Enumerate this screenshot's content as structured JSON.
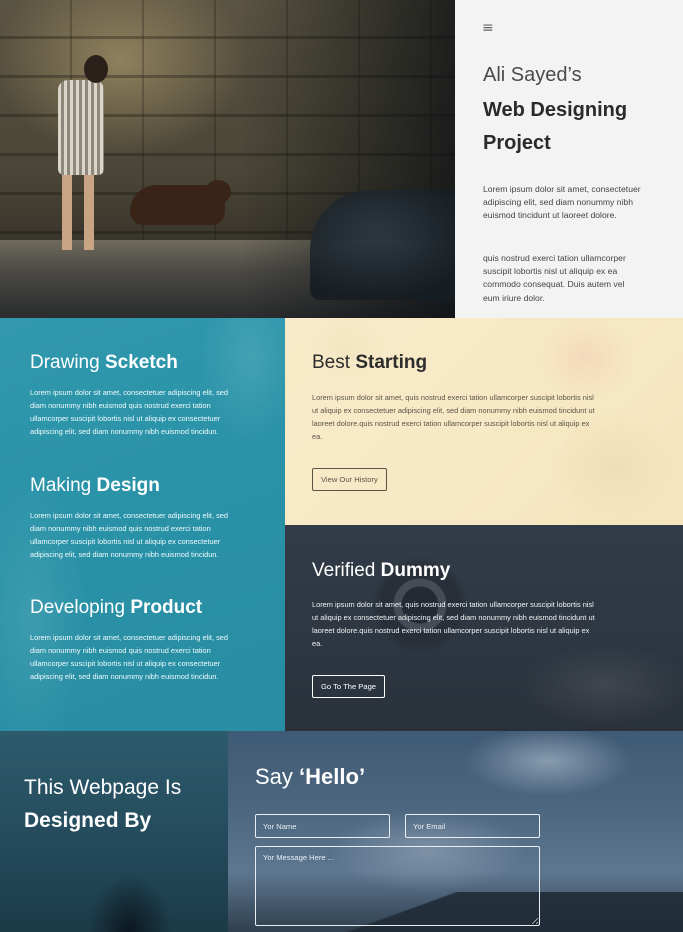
{
  "hero": {
    "menu_icon": "hamburger-icon",
    "author": "Ali Sayed’s",
    "project_title": "Web Designing Project",
    "paragraph_1": "Lorem ipsum dolor sit amet, consectetuer adipiscing elit, sed diam nonummy nibh euismod tincidunt ut laoreet dolore.",
    "paragraph_2": "quis nostrud exerci tation ullamcorper suscipit lobortis nisl ut aliquip ex ea commodo consequat. Duis autem vel eum iriure dolor."
  },
  "features": [
    {
      "title_light": "Drawing",
      "title_bold": "Scketch",
      "text": "Lorem ipsum dolor sit amet, consectetuer adipiscing elit, sed diam nonummy nibh euismod quis nostrud exerci tation ullamcorper suscipit lobortis nisl ut aliquip ex consectetuer adipiscing elit, sed diam nonummy nibh euismod tincidun."
    },
    {
      "title_light": "Making",
      "title_bold": "Design",
      "text": "Lorem ipsum dolor sit amet, consectetuer adipiscing elit, sed diam nonummy nibh euismod quis nostrud exerci tation ullamcorper suscipit lobortis nisl ut aliquip ex consectetuer adipiscing elit, sed diam nonummy nibh euismod tincidun."
    },
    {
      "title_light": "Developing",
      "title_bold": "Product",
      "text": "Lorem ipsum dolor sit amet, consectetuer adipiscing elit, sed diam nonummy nibh euismod quis nostrud exerci tation ullamcorper suscipit lobortis nisl ut aliquip ex consectetuer adipiscing elit, sed diam nonummy nibh euismod tincidun."
    }
  ],
  "best_starting": {
    "title_light": "Best",
    "title_bold": "Starting",
    "text": "Lorem ipsum dolor sit amet, quis nostrud exerci tation ullamcorper suscipit lobortis nisl ut aliquip ex consectetuer adipiscing elit, sed diam nonummy nibh euismod tincidunt ut laoreet dolore.quis nostrud exerci tation ullamcorper suscipit lobortis nisl ut aliquip ex ea.",
    "button_label": "View Our History"
  },
  "verified_dummy": {
    "title_light": "Verified",
    "title_bold": "Dummy",
    "text": "Lorem ipsum dolor sit amet, quis nostrud exerci tation ullamcorper suscipit lobortis nisl ut aliquip ex consectetuer adipiscing elit, sed diam nonummy nibh euismod tincidunt ut laoreet dolore.quis nostrud exerci tation ullamcorper suscipit lobortis nisl ut aliquip ex ea.",
    "button_label": "Go To The Page"
  },
  "designed_by": {
    "line_1": "This Webpage Is",
    "line_2": "Designed By"
  },
  "contact": {
    "title_light": "Say",
    "title_bold": "‘Hello’",
    "name_placeholder": "Yor Name",
    "email_placeholder": "Yor Email",
    "message_placeholder": "Yor Message Here ..."
  },
  "colors": {
    "hero_panel_bg": "#f3f3f3",
    "teal": "#2f93a8",
    "cream": "#f6e7c4",
    "slate": "#343d46",
    "footer_blue": "#23495a"
  }
}
